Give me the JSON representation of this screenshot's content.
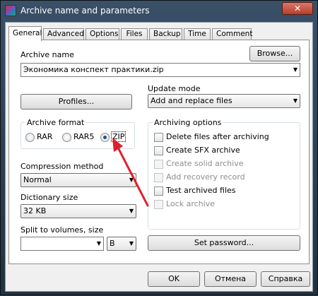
{
  "window": {
    "title": "Archive name and parameters",
    "close_label": "✕",
    "app_icon": "winrar-books-icon"
  },
  "tabs": [
    {
      "label": "General",
      "active": true
    },
    {
      "label": "Advanced",
      "active": false
    },
    {
      "label": "Options",
      "active": false
    },
    {
      "label": "Files",
      "active": false
    },
    {
      "label": "Backup",
      "active": false
    },
    {
      "label": "Time",
      "active": false
    },
    {
      "label": "Comment",
      "active": false
    }
  ],
  "archive_name": {
    "label": "Archive name",
    "value": "Экономика конспект практики.zip",
    "browse_label": "Browse..."
  },
  "update_mode": {
    "label": "Update mode",
    "value": "Add and replace files"
  },
  "profiles_label": "Profiles...",
  "archive_format": {
    "title": "Archive format",
    "options": [
      {
        "label": "RAR",
        "checked": false
      },
      {
        "label": "RAR5",
        "checked": false
      },
      {
        "label": "ZIP",
        "checked": true
      }
    ]
  },
  "compression_method": {
    "label": "Compression method",
    "value": "Normal"
  },
  "dictionary_size": {
    "label": "Dictionary size",
    "value": "32 KB"
  },
  "split_volumes": {
    "label": "Split to volumes, size",
    "value": "",
    "unit": "B"
  },
  "archiving_options": {
    "title": "Archiving options",
    "items": [
      {
        "label": "Delete files after archiving",
        "checked": false,
        "enabled": true
      },
      {
        "label": "Create SFX archive",
        "checked": false,
        "enabled": true
      },
      {
        "label": "Create solid archive",
        "checked": false,
        "enabled": false
      },
      {
        "label": "Add recovery record",
        "checked": false,
        "enabled": false
      },
      {
        "label": "Test archived files",
        "checked": false,
        "enabled": true
      },
      {
        "label": "Lock archive",
        "checked": false,
        "enabled": false
      }
    ]
  },
  "set_password_label": "Set password...",
  "footer": {
    "ok_label": "OK",
    "cancel_label": "Отмена",
    "help_label": "Справка"
  },
  "colors": {
    "annotation_arrow": "#e0202a",
    "radio_dot": "#1f4e95"
  }
}
